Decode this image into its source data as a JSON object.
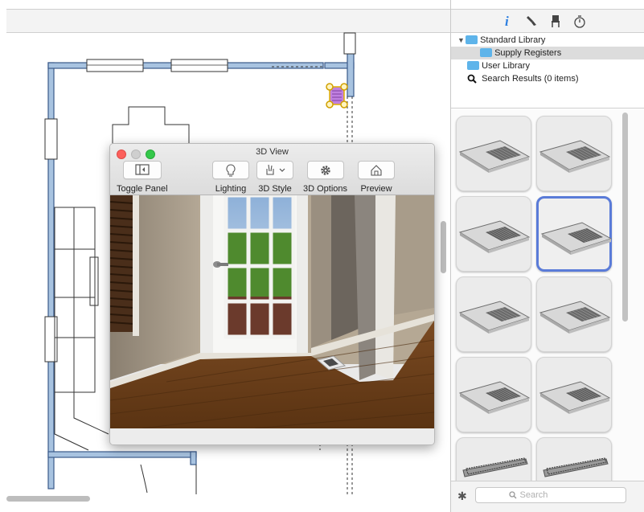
{
  "window_3d": {
    "title": "3D View",
    "toolbar": {
      "toggle_panel": "Toggle Panel",
      "lighting": "Lighting",
      "style": "3D Style",
      "options": "3D Options",
      "preview": "Preview"
    }
  },
  "library": {
    "tabs": [
      "info-icon",
      "brush-icon",
      "chair-icon",
      "timer-icon"
    ],
    "tree": {
      "standard_library": "Standard Library",
      "supply_registers": "Supply Registers",
      "user_library": "User Library",
      "search_results": "Search Results (0 items)"
    },
    "selected_tile_index": 3,
    "search_placeholder": "Search"
  },
  "colors": {
    "wall": "#a8c3e0",
    "wall_stroke": "#3a5a8a",
    "accent_selection": "#5a7bd8",
    "folder": "#5eb4ea"
  }
}
